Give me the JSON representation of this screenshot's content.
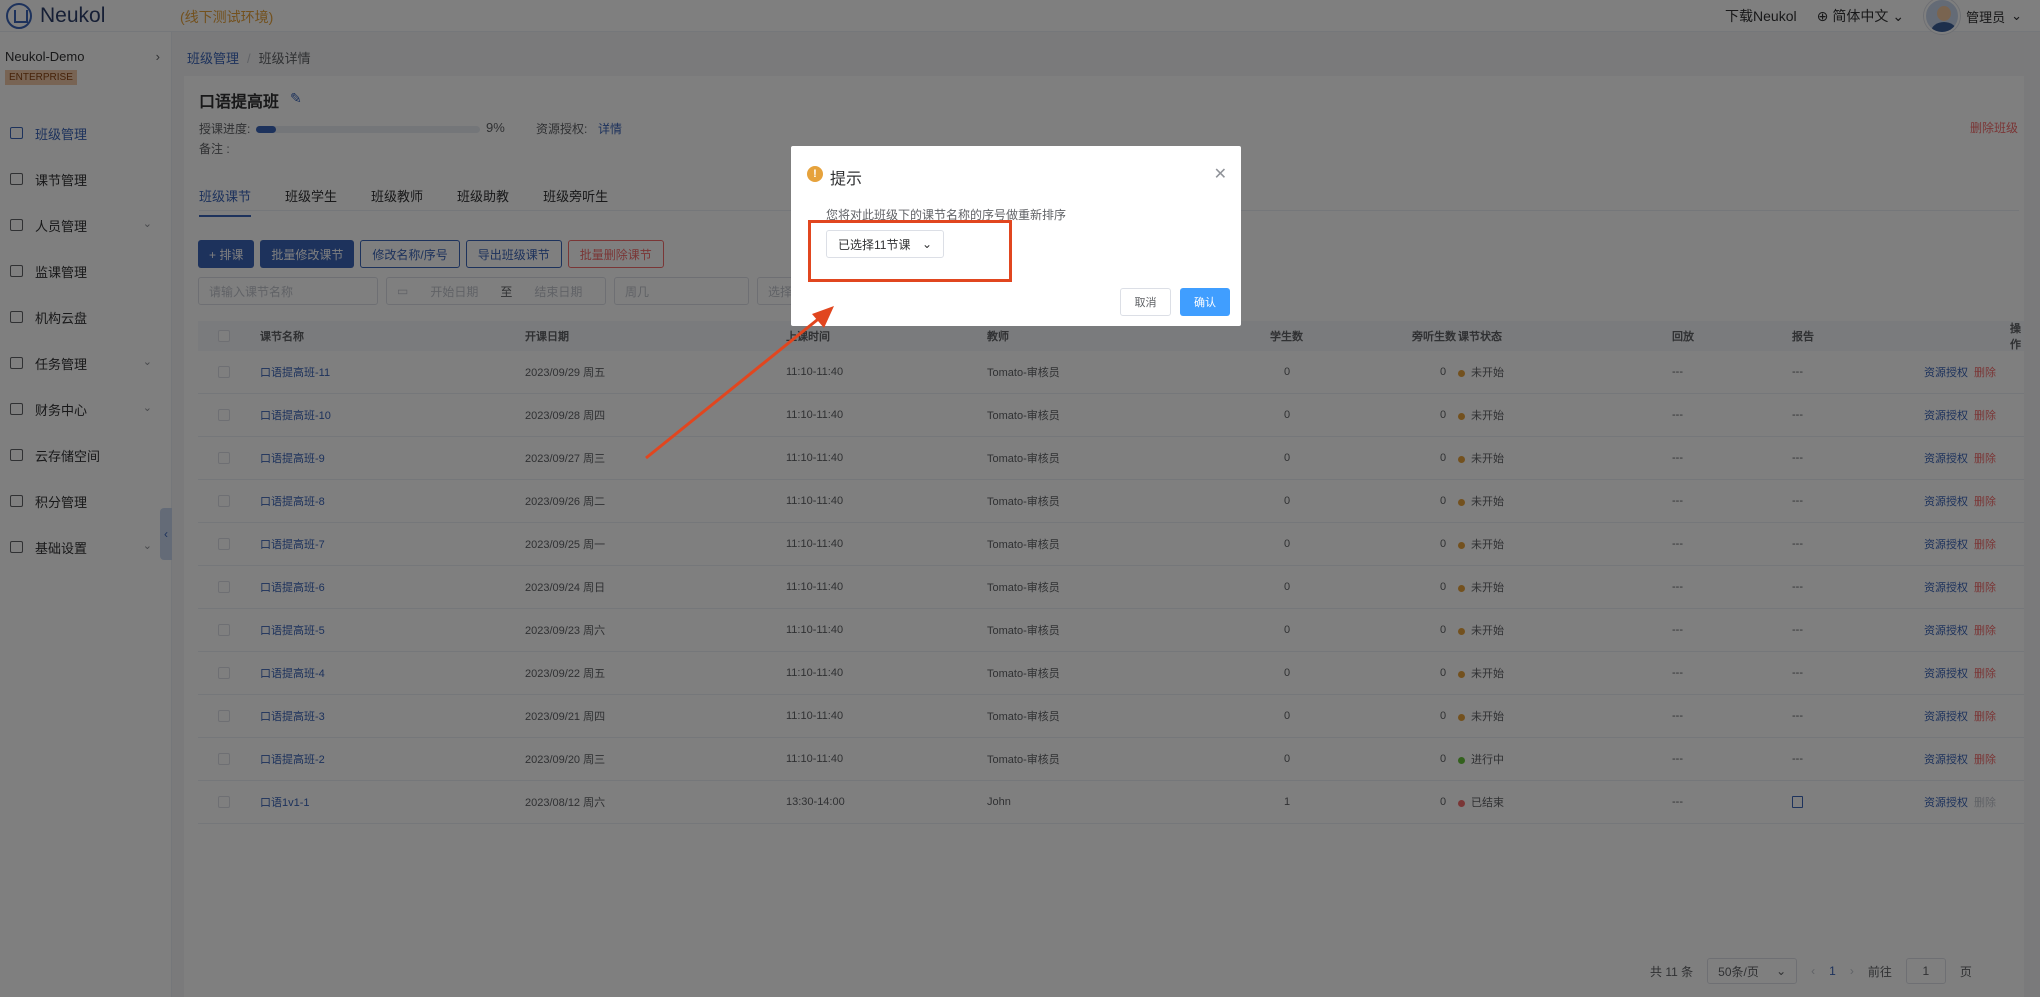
{
  "header": {
    "logo_text": "Neukol",
    "env_label": "(线下测试环境)",
    "download": "下载Neukol",
    "language": "简体中文",
    "user": "管理员"
  },
  "sidebar": {
    "org": "Neukol-Demo",
    "badge": "ENTERPRISE",
    "items": [
      {
        "label": "班级管理",
        "icon": "class-icon"
      },
      {
        "label": "课节管理",
        "icon": "lesson-icon"
      },
      {
        "label": "人员管理",
        "icon": "people-icon"
      },
      {
        "label": "监课管理",
        "icon": "monitor-icon"
      },
      {
        "label": "机构云盘",
        "icon": "cloud-icon"
      },
      {
        "label": "任务管理",
        "icon": "task-icon"
      },
      {
        "label": "财务中心",
        "icon": "finance-icon"
      },
      {
        "label": "云存储空间",
        "icon": "storage-icon"
      },
      {
        "label": "积分管理",
        "icon": "points-icon"
      },
      {
        "label": "基础设置",
        "icon": "settings-icon"
      }
    ]
  },
  "breadcrumb": {
    "parent": "班级管理",
    "current": "班级详情"
  },
  "class_info": {
    "title": "口语提高班",
    "progress_label": "授课进度:",
    "progress": 0.09,
    "progress_text": "9%",
    "resource_label": "资源授权:",
    "resource_link": "详情",
    "remark_label": "备注 :",
    "delete": "删除班级"
  },
  "tabs": [
    "班级课节",
    "班级学生",
    "班级教师",
    "班级助教",
    "班级旁听生"
  ],
  "toolbar": [
    "+ 排课",
    "批量修改课节",
    "修改名称/序号",
    "导出班级课节",
    "批量删除课节"
  ],
  "filters": {
    "name_placeholder": "请输入课节名称",
    "start_date": "开始日期",
    "to": "至",
    "end_date": "结束日期",
    "weekday": "周几",
    "select": "选择"
  },
  "table": {
    "columns": [
      "课节名称",
      "开课日期",
      "上课时间",
      "教师",
      "学生数",
      "旁听生数",
      "课节状态",
      "回放",
      "报告",
      "操作"
    ],
    "rows": [
      {
        "name": "口语提高班-11",
        "date": "2023/09/29 周五",
        "time": "11:10-11:40",
        "teacher": "Tomato-审核员",
        "students": "0",
        "auditors": "0",
        "status": "未开始",
        "status_color": "#e6a23c",
        "replay": "---",
        "report": "---",
        "op1": "资源授权",
        "op2": "删除"
      },
      {
        "name": "口语提高班-10",
        "date": "2023/09/28 周四",
        "time": "11:10-11:40",
        "teacher": "Tomato-审核员",
        "students": "0",
        "auditors": "0",
        "status": "未开始",
        "status_color": "#e6a23c",
        "replay": "---",
        "report": "---",
        "op1": "资源授权",
        "op2": "删除"
      },
      {
        "name": "口语提高班-9",
        "date": "2023/09/27 周三",
        "time": "11:10-11:40",
        "teacher": "Tomato-审核员",
        "students": "0",
        "auditors": "0",
        "status": "未开始",
        "status_color": "#e6a23c",
        "replay": "---",
        "report": "---",
        "op1": "资源授权",
        "op2": "删除"
      },
      {
        "name": "口语提高班-8",
        "date": "2023/09/26 周二",
        "time": "11:10-11:40",
        "teacher": "Tomato-审核员",
        "students": "0",
        "auditors": "0",
        "status": "未开始",
        "status_color": "#e6a23c",
        "replay": "---",
        "report": "---",
        "op1": "资源授权",
        "op2": "删除"
      },
      {
        "name": "口语提高班-7",
        "date": "2023/09/25 周一",
        "time": "11:10-11:40",
        "teacher": "Tomato-审核员",
        "students": "0",
        "auditors": "0",
        "status": "未开始",
        "status_color": "#e6a23c",
        "replay": "---",
        "report": "---",
        "op1": "资源授权",
        "op2": "删除"
      },
      {
        "name": "口语提高班-6",
        "date": "2023/09/24 周日",
        "time": "11:10-11:40",
        "teacher": "Tomato-审核员",
        "students": "0",
        "auditors": "0",
        "status": "未开始",
        "status_color": "#e6a23c",
        "replay": "---",
        "report": "---",
        "op1": "资源授权",
        "op2": "删除"
      },
      {
        "name": "口语提高班-5",
        "date": "2023/09/23 周六",
        "time": "11:10-11:40",
        "teacher": "Tomato-审核员",
        "students": "0",
        "auditors": "0",
        "status": "未开始",
        "status_color": "#e6a23c",
        "replay": "---",
        "report": "---",
        "op1": "资源授权",
        "op2": "删除"
      },
      {
        "name": "口语提高班-4",
        "date": "2023/09/22 周五",
        "time": "11:10-11:40",
        "teacher": "Tomato-审核员",
        "students": "0",
        "auditors": "0",
        "status": "未开始",
        "status_color": "#e6a23c",
        "replay": "---",
        "report": "---",
        "op1": "资源授权",
        "op2": "删除"
      },
      {
        "name": "口语提高班-3",
        "date": "2023/09/21 周四",
        "time": "11:10-11:40",
        "teacher": "Tomato-审核员",
        "students": "0",
        "auditors": "0",
        "status": "未开始",
        "status_color": "#e6a23c",
        "replay": "---",
        "report": "---",
        "op1": "资源授权",
        "op2": "删除"
      },
      {
        "name": "口语提高班-2",
        "date": "2023/09/20 周三",
        "time": "11:10-11:40",
        "teacher": "Tomato-审核员",
        "students": "0",
        "auditors": "0",
        "status": "进行中",
        "status_color": "#67c23a",
        "replay": "---",
        "report": "---",
        "op1": "资源授权",
        "op2": "删除"
      },
      {
        "name": "口语1v1-1",
        "date": "2023/08/12 周六",
        "time": "13:30-14:00",
        "teacher": "John",
        "students": "1",
        "auditors": "0",
        "status": "已结束",
        "status_color": "#f56c6c",
        "replay": "---",
        "report": "report-icon",
        "op1": "资源授权",
        "op2": "删除"
      }
    ]
  },
  "pager": {
    "total": "共 11 条",
    "page_size": "50条/页",
    "page": "1",
    "goto": "前往",
    "goto_value": "1",
    "unit": "页"
  },
  "dialog": {
    "title": "提示",
    "message": "您将对此班级下的课节名称的序号做重新排序",
    "select_value": "已选择11节课",
    "cancel": "取消",
    "confirm": "确认"
  }
}
